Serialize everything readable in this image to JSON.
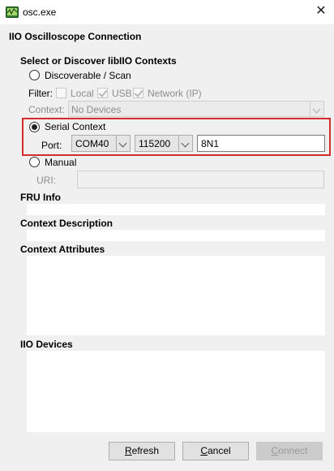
{
  "window": {
    "title": "osc.exe",
    "close_glyph": "✕",
    "app_icon": "oscilloscope-icon"
  },
  "dialog": {
    "heading": "IIO Oscilloscope Connection",
    "discover_heading": "Select or Discover libIIO Contexts",
    "options": {
      "discoverable_label": "Discoverable / Scan",
      "serial_label": "Serial Context",
      "manual_label": "Manual",
      "selected": "serial"
    },
    "filter": {
      "label": "Filter:",
      "local_label": "Local",
      "usb_label": "USB",
      "network_label": "Network (IP)"
    },
    "context": {
      "label": "Context:",
      "value": "No Devices"
    },
    "serial": {
      "port_label": "Port:",
      "port_value": "COM40",
      "baud_value": "115200",
      "format_value": "8N1"
    },
    "uri": {
      "label": "URI:",
      "value": ""
    },
    "sections": {
      "fru_info": "FRU Info",
      "context_description": "Context Description",
      "context_attributes": "Context Attributes",
      "iio_devices": "IIO Devices"
    },
    "buttons": {
      "refresh_prefix": "R",
      "refresh_rest": "efresh",
      "cancel_prefix": "C",
      "cancel_rest": "ancel",
      "connect_prefix": "C",
      "connect_rest": "onnect"
    }
  },
  "colors": {
    "highlight_border": "#d62b2b",
    "background": "#f0f0f0"
  }
}
